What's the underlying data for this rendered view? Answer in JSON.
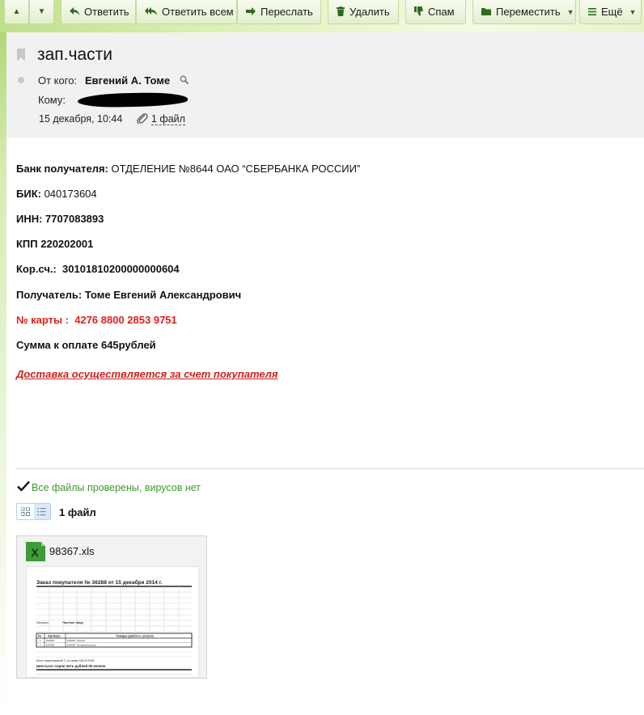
{
  "toolbar": {
    "up_label": "▲",
    "down_label": "▼",
    "reply": "Ответить",
    "reply_all": "Ответить всем",
    "forward": "Переслать",
    "delete": "Удалить",
    "spam": "Спам",
    "move": "Переместить",
    "more": "Ещё"
  },
  "message": {
    "subject": "зап.части",
    "from_label": "От кого:",
    "from_name": "Евгений А. Томе",
    "to_label": "Кому:",
    "date": "15 декабря, 10:44",
    "files_link": "1 файл"
  },
  "body": {
    "bank_label": "Банк получателя:",
    "bank_value": " ОТДЕЛЕНИЕ №8644 ОАО “СБЕРБАНКА РОССИИ”",
    "bik_label": "БИК:",
    "bik_value": " 040173604",
    "inn": "ИНН: 7707083893",
    "kpp": "КПП 220202001",
    "kor": "Кор.сч.:  30101810200000000604",
    "recipient": "Получатель: Томе Евгений Александрович",
    "card": "№ карты :  4276 8800 2853 9751",
    "sum": "Сумма к оплате 645рублей",
    "delivery": "Доставка осуществляется за счет покупателя"
  },
  "attachments": {
    "virus_check": "Все файлы проверены, вирусов нет",
    "count_label": "1 файл",
    "items": [
      {
        "name": "98367.xls",
        "preview_title": "Заказ покупателя № 36288 от 15 декабря 2014 г.",
        "preview_buyer_label": "Заказчик:",
        "preview_buyer_value": "Частное лицо",
        "preview_col_num": "№",
        "preview_col_article": "Артикул",
        "preview_col_goods": "Товары (работы, услуги)",
        "preview_row1": "ENR087 Тормозн.",
        "preview_row2": "ENR087 Топливный фильтр",
        "preview_total": "Всего наименований 2, на сумму 645,00 RUB",
        "preview_words": "Шестьсот сорок пять рублей 00 копеек"
      }
    ]
  },
  "colors": {
    "toolbar_icon": "#2e6b1e",
    "card_red": "#e0201b",
    "virus_green": "#3c9a2c",
    "header_bg": "#f1f1f1"
  }
}
